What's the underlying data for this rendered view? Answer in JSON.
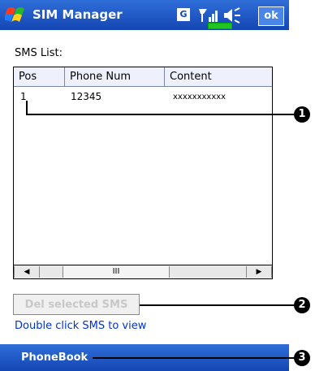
{
  "window": {
    "title": "SIM Manager",
    "network_badge": "G",
    "ok_label": "ok"
  },
  "sms_list": {
    "label": "SMS List:",
    "columns": [
      "Pos",
      "Phone Num",
      "Content"
    ],
    "rows": [
      {
        "pos": "1",
        "phone": "12345",
        "content": "xxxxxxxxxxx"
      }
    ],
    "scroll_thumb": "III"
  },
  "actions": {
    "delete_label": "Del selected SMS",
    "hint": "Double click SMS to view"
  },
  "softkeys": {
    "left": "PhoneBook"
  },
  "callouts": [
    "1",
    "2",
    "3"
  ],
  "colors": {
    "titlebar": "#1446b4",
    "hint_text": "#0033cc",
    "disabled_text": "#c8c8c8"
  }
}
